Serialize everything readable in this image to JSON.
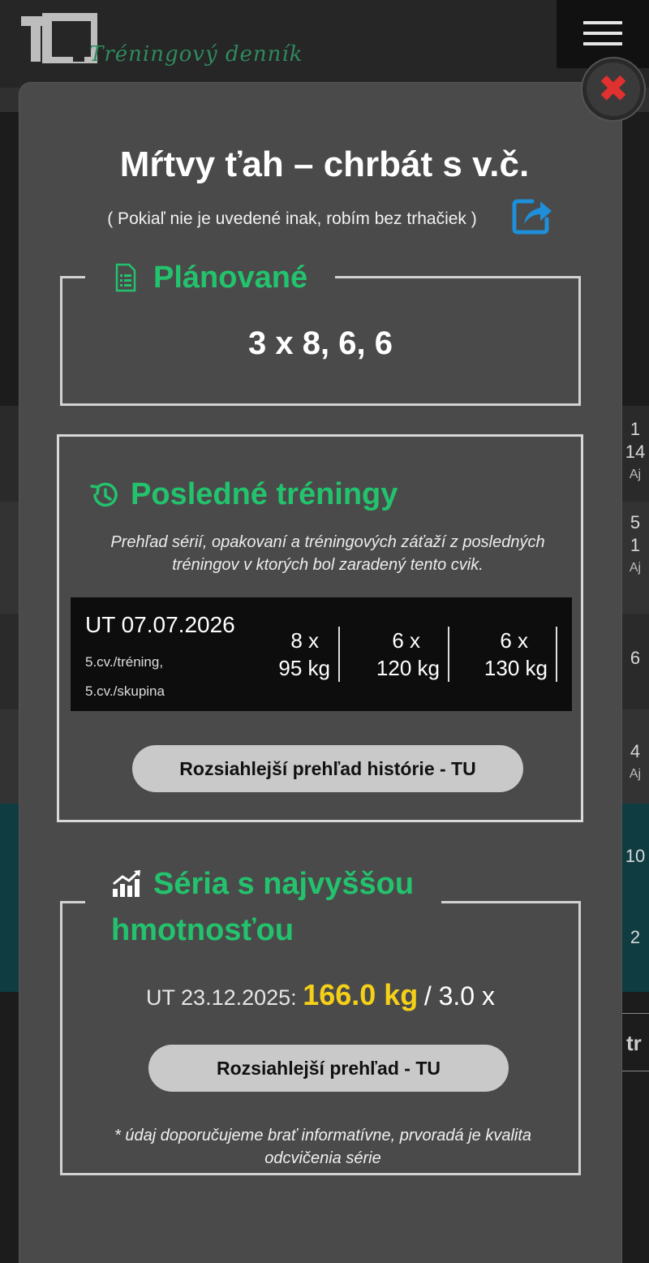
{
  "app": {
    "logo_text": "TQ",
    "tagline": "Tréningový denník"
  },
  "background_rows": [
    {
      "line1": "1",
      "line2": "14",
      "line3": "Aj"
    },
    {
      "line1": "5",
      "line2": "1",
      "line3": "Aj"
    },
    {
      "line1": "6",
      "line2": "",
      "line3": ""
    },
    {
      "line1": "4",
      "line2": "Aj",
      "line3": ""
    },
    {
      "line1": "10",
      "line2": "",
      "line3": ""
    },
    {
      "line1": "2",
      "line2": "",
      "line3": ""
    }
  ],
  "background_fragment": "tr",
  "modal": {
    "close_symbol": "✖",
    "title": "Mŕtvy ťah – chrbát s v.č.",
    "subtitle": "( Pokiaľ nie je uvedené inak, robím bez trhačiek )",
    "planned": {
      "label": "Plánované",
      "value": "3 x 8, 6, 6"
    },
    "last_trainings": {
      "label": "Posledné tréningy",
      "description": "Prehľad sérií, opakovaní a tréningových záťaží z posledných tréningov v ktorých bol zaradený tento cvik.",
      "entry": {
        "date": "UT 07.07.2026",
        "meta1": "5.cv./tréning,",
        "meta2": "5.cv./skupina",
        "sets": [
          {
            "reps": "8 x",
            "weight": "95 kg"
          },
          {
            "reps": "6 x",
            "weight": "120 kg"
          },
          {
            "reps": "6 x",
            "weight": "130 kg"
          }
        ]
      },
      "button_label": "Rozsiahlejší prehľad histórie - TU"
    },
    "heaviest_series": {
      "label_line1": "Séria s najvyššou",
      "label_line2": "hmotnosťou",
      "date_prefix": "UT 23.12.2025:",
      "weight": "166.0 kg",
      "reps": "/ 3.0 x",
      "button_label": "Rozsiahlejší prehľad - TU",
      "note": "* údaj doporučujeme brať informatívne, prvoradá je kvalita odcvičenia série"
    }
  },
  "colors": {
    "accent_green": "#23c36e",
    "weight_yellow": "#f5d018",
    "close_red": "#e03030",
    "share_blue": "#1e8fd8"
  }
}
